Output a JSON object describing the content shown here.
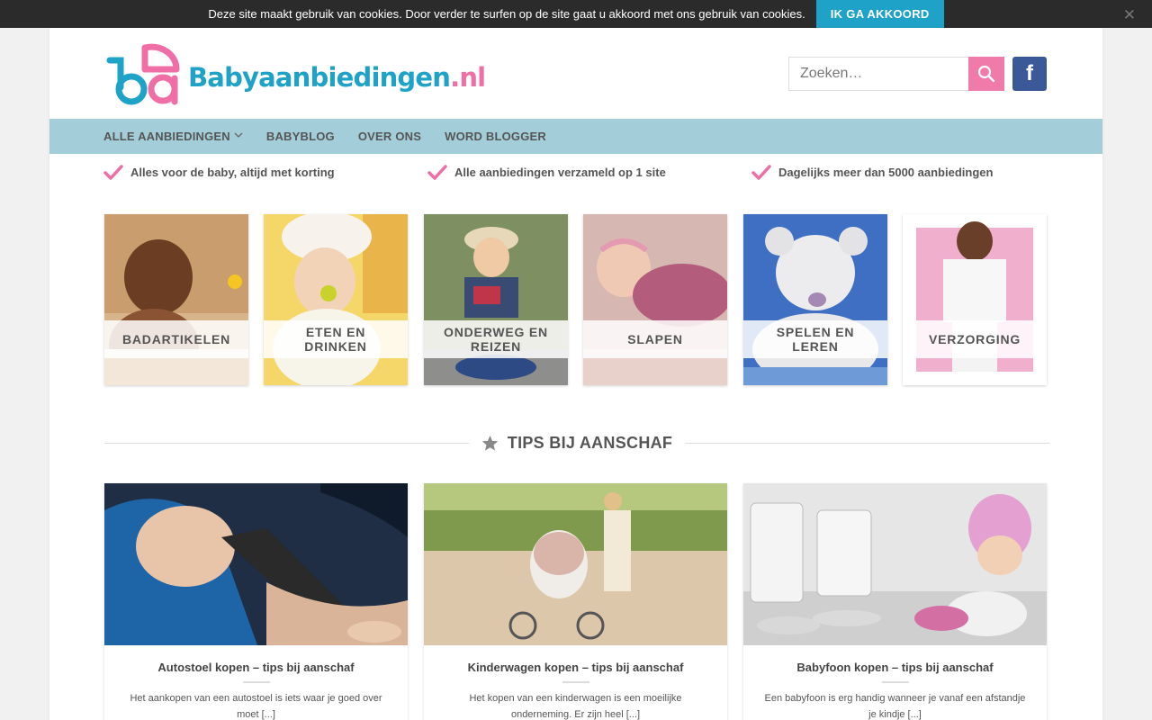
{
  "cookie": {
    "text": "Deze site maakt gebruik van cookies. Door verder te surfen op de site gaat u akkoord met ons gebruik van cookies.",
    "accept": "IK GA AKKOORD",
    "close": "✕"
  },
  "header": {
    "logo_main": "Babyaanbiedingen",
    "logo_tld": ".nl",
    "search_placeholder": "Zoeken…",
    "facebook": "f"
  },
  "nav": {
    "items": [
      "ALLE AANBIEDINGEN",
      "BABYBLOG",
      "OVER ONS",
      "WORD BLOGGER"
    ]
  },
  "usps": [
    "Alles voor de baby, altijd met korting",
    "Alle aanbiedingen verzameld op 1 site",
    "Dagelijks meer dan 5000 aanbiedingen"
  ],
  "categories": [
    {
      "label": "BADARTIKELEN"
    },
    {
      "label": "ETEN EN DRINKEN"
    },
    {
      "label": "ONDERWEG EN REIZEN"
    },
    {
      "label": "SLAPEN"
    },
    {
      "label": "SPELEN EN LEREN"
    },
    {
      "label": "VERZORGING"
    }
  ],
  "section": {
    "title": "TIPS BIJ AANSCHAF"
  },
  "posts": [
    {
      "title": "Autostoel kopen – tips bij aanschaf",
      "excerpt": "Het aankopen van een autostoel is iets waar je goed over moet [...]"
    },
    {
      "title": "Kinderwagen kopen – tips bij aanschaf",
      "excerpt": "Het kopen van een kinderwagen is een moeilijke onderneming. Er zijn heel [...]"
    },
    {
      "title": "Babyfoon kopen – tips bij aanschaf",
      "excerpt": "Een babyfoon is erg handig wanneer je vanaf een afstandje je kindje [...]"
    }
  ],
  "colors": {
    "brand_blue": "#1fa2c7",
    "brand_pink": "#ef6ea5",
    "nav_bg": "#a3ced9",
    "facebook": "#3b5998"
  }
}
